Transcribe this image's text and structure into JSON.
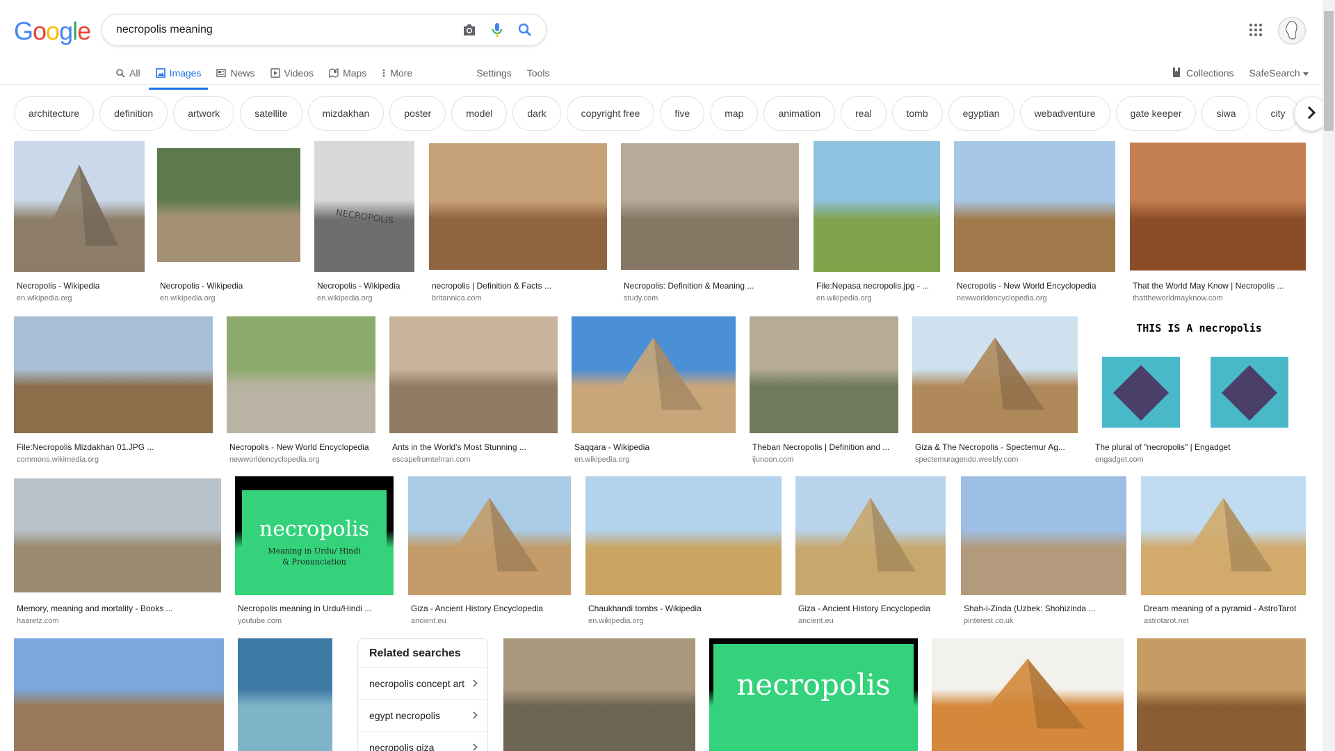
{
  "header": {
    "logo_letters": [
      "G",
      "o",
      "o",
      "g",
      "l",
      "e"
    ],
    "query": "necropolis meaning",
    "icons": [
      "camera-icon",
      "microphone-icon",
      "search-icon"
    ]
  },
  "tabs": [
    {
      "label": "All",
      "icon": "search-icon",
      "active": false
    },
    {
      "label": "Images",
      "icon": "image-icon",
      "active": true
    },
    {
      "label": "News",
      "icon": "news-icon",
      "active": false
    },
    {
      "label": "Videos",
      "icon": "play-icon",
      "active": false
    },
    {
      "label": "Maps",
      "icon": "map-pin-icon",
      "active": false
    },
    {
      "label": "More",
      "icon": "more-vertical-icon",
      "active": false
    },
    {
      "label": "Settings",
      "icon": "",
      "active": false
    },
    {
      "label": "Tools",
      "icon": "",
      "active": false
    }
  ],
  "right_links": {
    "collections": "Collections",
    "safesearch": "SafeSearch"
  },
  "chips": [
    "architecture",
    "definition",
    "artwork",
    "satellite",
    "mizdakhan",
    "poster",
    "model",
    "dark",
    "copyright free",
    "five",
    "map",
    "animation",
    "real",
    "tomb",
    "egyptian",
    "webadventure",
    "gate keeper",
    "siwa",
    "city"
  ],
  "results": [
    {
      "caption": "Necropolis - Wikipedia",
      "source": "en.wikipedia.org",
      "palette": [
        "#c9d9ea",
        "#8d7d68"
      ]
    },
    {
      "caption": "Necropolis - Wikipedia",
      "source": "en.wikipedia.org",
      "palette": [
        "#5d7a4c",
        "#a59274"
      ]
    },
    {
      "caption": "Necropolis - Wikipedia",
      "source": "en.wikipedia.org",
      "palette": [
        "#d8d8d8",
        "#6e6e6e"
      ]
    },
    {
      "caption": "necropolis | Definition & Facts ...",
      "source": "britannica.com",
      "palette": [
        "#c7a177",
        "#8f6441"
      ]
    },
    {
      "caption": "Necropolis: Definition & Meaning ...",
      "source": "study.com",
      "palette": [
        "#b7aa99",
        "#857764"
      ]
    },
    {
      "caption": "File:Nepasa necropolis.jpg - ...",
      "source": "en.wikipedia.org",
      "palette": [
        "#8fc2de",
        "#7ea34b"
      ]
    },
    {
      "caption": "Necropolis - New World Encyclopedia",
      "source": "newworldencyclopedia.org",
      "palette": [
        "#a8c7e8",
        "#a17a4c"
      ]
    },
    {
      "caption": "That the World May Know | Necropolis ...",
      "source": "thattheworldmayknow.com",
      "palette": [
        "#c48052",
        "#8b4c27"
      ]
    },
    {
      "caption": "File:Necropolis Mizdakhan 01.JPG ...",
      "source": "commons.wikimedia.org",
      "palette": [
        "#a8c0d6",
        "#8c6e4b"
      ]
    },
    {
      "caption": "Necropolis - New World Encyclopedia",
      "source": "newworldencyclopedia.org",
      "palette": [
        "#8caa6c",
        "#b9b3a4"
      ]
    },
    {
      "caption": "Ants in the World's Most Stunning ...",
      "source": "escapefromtehran.com",
      "palette": [
        "#c8b49a",
        "#8f7b62"
      ]
    },
    {
      "caption": "Saqqara - Wikipedia",
      "source": "en.wikipedia.org",
      "palette": [
        "#4b8fd6",
        "#c9a679"
      ]
    },
    {
      "caption": "Theban Necropolis | Definition and ...",
      "source": "ijunoon.com",
      "palette": [
        "#b5ab96",
        "#6f7a5a"
      ]
    },
    {
      "caption": "Giza & The Necropolis - Spectemur Ag...",
      "source": "spectemuragendo.weebly.com",
      "palette": [
        "#cfe0ef",
        "#b0895b"
      ]
    },
    {
      "caption": "The plural of \"necropolis\" | Engadget",
      "source": "engadget.com",
      "palette": [
        "#ffffff",
        "#49b9c9"
      ]
    },
    {
      "caption": "Memory, meaning and mortality - Books ...",
      "source": "haaretz.com",
      "palette": [
        "#b9c3cc",
        "#9b8b72"
      ]
    },
    {
      "caption": "Necropolis meaning in Urdu/Hindi ...",
      "source": "youtube.com",
      "palette": [
        "#000000",
        "#33d27b"
      ]
    },
    {
      "caption": "Giza - Ancient History Encyclopedia",
      "source": "ancient.eu",
      "palette": [
        "#a9cbe5",
        "#c49c6a"
      ]
    },
    {
      "caption": "Chaukhandi tombs - Wikipedia",
      "source": "en.wikipedia.org",
      "palette": [
        "#b3d2ee",
        "#c9a462"
      ]
    },
    {
      "caption": "Giza - Ancient History Encyclopedia",
      "source": "ancient.eu",
      "palette": [
        "#b9d3ea",
        "#c8a76f"
      ]
    },
    {
      "caption": "Shah-i-Zinda (Uzbek: Shohizinda ...",
      "source": "pinterest.co.uk",
      "palette": [
        "#9dbfe4",
        "#b49a7c"
      ]
    },
    {
      "caption": "Dream meaning of a pyramid - AstroTarot",
      "source": "astrotarot.net",
      "palette": [
        "#c1dcf1",
        "#d1aa6c"
      ]
    },
    {
      "caption": "",
      "source": "",
      "palette": [
        "#7aa7dd",
        "#9a7a5b"
      ]
    },
    {
      "caption": "",
      "source": "",
      "palette": [
        "#3f7aa6",
        "#7fb3c8"
      ]
    },
    {
      "caption": "",
      "source": "",
      "palette": [
        "#a8987e",
        "#6f6555"
      ]
    },
    {
      "caption": "",
      "source": "",
      "palette": [
        "#000000",
        "#33d27b"
      ],
      "text": "necropolis"
    },
    {
      "caption": "",
      "source": "",
      "palette": [
        "#f3f1ec",
        "#d3883b"
      ]
    },
    {
      "caption": "",
      "source": "",
      "palette": [
        "#c79b64",
        "#8b5d35"
      ]
    }
  ],
  "overlay_text": {
    "r3": "NECROPOLIS",
    "r15": "THIS IS A necropolis",
    "r17_title": "necropolis",
    "r17_sub1": "Meaning in Urdu/ Hindi",
    "r17_sub2": "& Pronunciation"
  },
  "related": {
    "title": "Related searches",
    "items": [
      "necropolis concept art",
      "egypt necropolis",
      "necropolis giza"
    ]
  }
}
